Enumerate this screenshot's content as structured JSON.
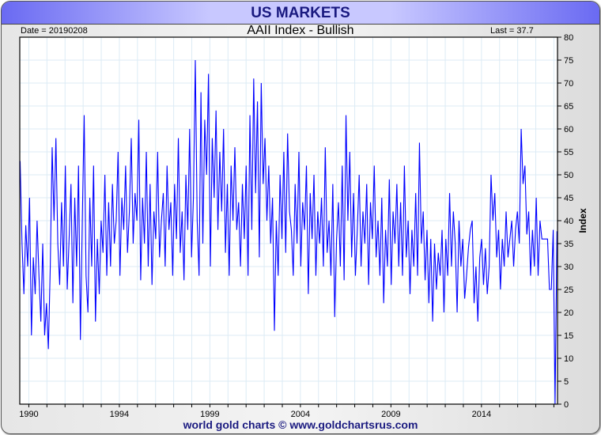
{
  "header": {
    "title": "US MARKETS"
  },
  "footer": {
    "credit": "world gold charts © www.goldchartsrus.com"
  },
  "chart_data": {
    "type": "line",
    "title": "AAII Index - Bullish",
    "date_label": "Date = 20190208",
    "last_label": "Last = 37.7",
    "ylabel": "Index",
    "xlabel": "",
    "ylim": [
      0,
      80
    ],
    "xlim": [
      1988.5,
      2018.2
    ],
    "yticks": [
      0,
      5,
      10,
      15,
      20,
      25,
      30,
      35,
      40,
      45,
      50,
      55,
      60,
      65,
      70,
      75,
      80
    ],
    "xticks": [
      {
        "value": 1989,
        "label": "1990"
      },
      {
        "value": 1994,
        "label": "1994"
      },
      {
        "value": 1999,
        "label": "1999"
      },
      {
        "value": 2004,
        "label": "2004"
      },
      {
        "value": 2009,
        "label": "2009"
      },
      {
        "value": 2014,
        "label": "2014"
      }
    ],
    "grid": true,
    "line_color": "#0000ff",
    "series": [
      {
        "name": "AAII Bullish",
        "values": [
          53,
          35,
          24,
          39,
          30,
          45,
          15,
          32,
          24,
          40,
          28,
          18,
          35,
          15,
          22,
          12,
          30,
          56,
          40,
          58,
          35,
          26,
          44,
          30,
          52,
          25,
          36,
          48,
          22,
          45,
          30,
          52,
          14,
          40,
          63,
          28,
          20,
          45,
          30,
          52,
          18,
          36,
          24,
          40,
          33,
          50,
          28,
          44,
          30,
          48,
          35,
          40,
          55,
          28,
          45,
          38,
          52,
          33,
          42,
          58,
          35,
          46,
          40,
          62,
          27,
          45,
          35,
          55,
          30,
          48,
          26,
          42,
          36,
          55,
          32,
          40,
          46,
          30,
          52,
          38,
          44,
          28,
          48,
          36,
          58,
          33,
          42,
          27,
          50,
          38,
          60,
          32,
          45,
          75,
          40,
          28,
          68,
          35,
          62,
          50,
          72,
          30,
          58,
          45,
          64,
          38,
          55,
          42,
          60,
          33,
          48,
          28,
          52,
          40,
          56,
          38,
          44,
          30,
          48,
          36,
          52,
          28,
          63,
          38,
          71,
          46,
          66,
          32,
          70,
          48,
          58,
          40,
          52,
          35,
          45,
          16,
          40,
          28,
          50,
          36,
          55,
          33,
          59,
          42,
          38,
          28,
          48,
          35,
          55,
          30,
          44,
          38,
          52,
          24,
          46,
          36,
          50,
          28,
          42,
          35,
          45,
          30,
          56,
          33,
          40,
          28,
          48,
          19,
          36,
          44,
          30,
          52,
          27,
          63,
          40,
          55,
          32,
          46,
          28,
          38,
          50,
          30,
          42,
          35,
          48,
          26,
          44,
          36,
          52,
          32,
          40,
          28,
          45,
          22,
          38,
          30,
          49,
          26,
          42,
          35,
          48,
          30,
          44,
          28,
          52,
          32,
          40,
          24,
          38,
          30,
          46,
          28,
          57,
          35,
          42,
          27,
          38,
          22,
          36,
          18,
          35,
          25,
          33,
          28,
          38,
          20,
          36,
          28,
          46,
          30,
          42,
          35,
          20,
          40,
          30,
          36,
          23,
          28,
          34,
          38,
          40,
          22,
          30,
          18,
          32,
          36,
          26,
          34,
          24,
          30,
          50,
          40,
          46,
          32,
          38,
          25,
          36,
          30,
          42,
          32,
          36,
          40,
          30,
          38,
          42,
          35,
          60,
          48,
          52,
          37,
          42,
          28,
          38,
          30,
          45,
          28,
          40,
          36,
          36,
          36,
          36,
          25,
          25,
          38,
          0,
          37.7
        ]
      }
    ]
  }
}
